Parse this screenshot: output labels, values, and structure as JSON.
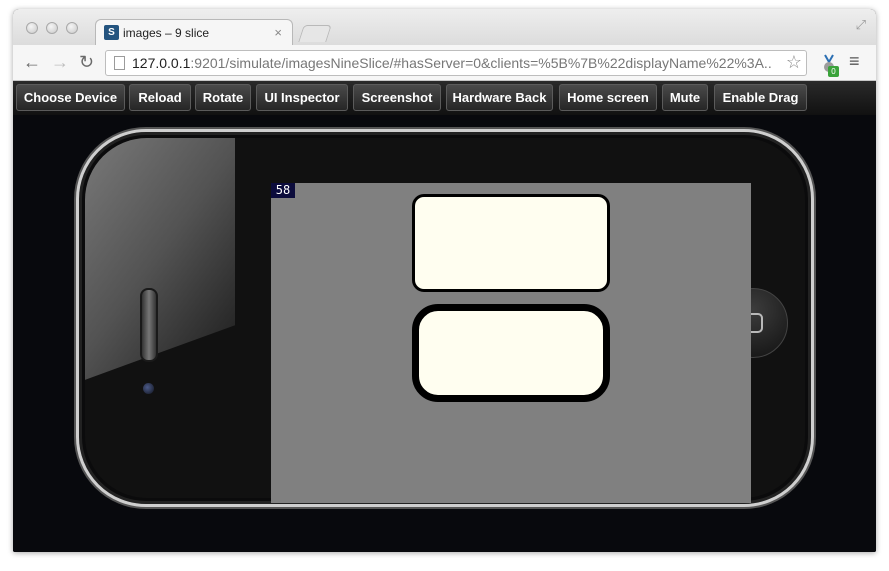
{
  "tab": {
    "title": "images – 9 slice",
    "favicon": "game-engine-icon",
    "close": "×"
  },
  "address": {
    "host": "127.0.0.1",
    "rest": ":9201/simulate/imagesNineSlice/#hasServer=0&clients=%5B%7B%22displayName%22%3A..."
  },
  "nav": {
    "back": "←",
    "forward": "→",
    "reload": "↻",
    "star": "☆",
    "menu": "≡",
    "resize": "⤢"
  },
  "extension": {
    "badge": "0"
  },
  "toolbar": {
    "choose_device": "Choose Device",
    "reload": "Reload",
    "rotate": "Rotate",
    "ui_inspector": "UI Inspector",
    "screenshot": "Screenshot",
    "hardware_back": "Hardware Back",
    "home_screen": "Home screen",
    "mute": "Mute",
    "enable_drag": "Enable Drag"
  },
  "simulator": {
    "fps": "58"
  },
  "colors": {
    "screen_bg": "#808080",
    "panel_fill": "#fffef0",
    "panel_border": "#000000"
  }
}
